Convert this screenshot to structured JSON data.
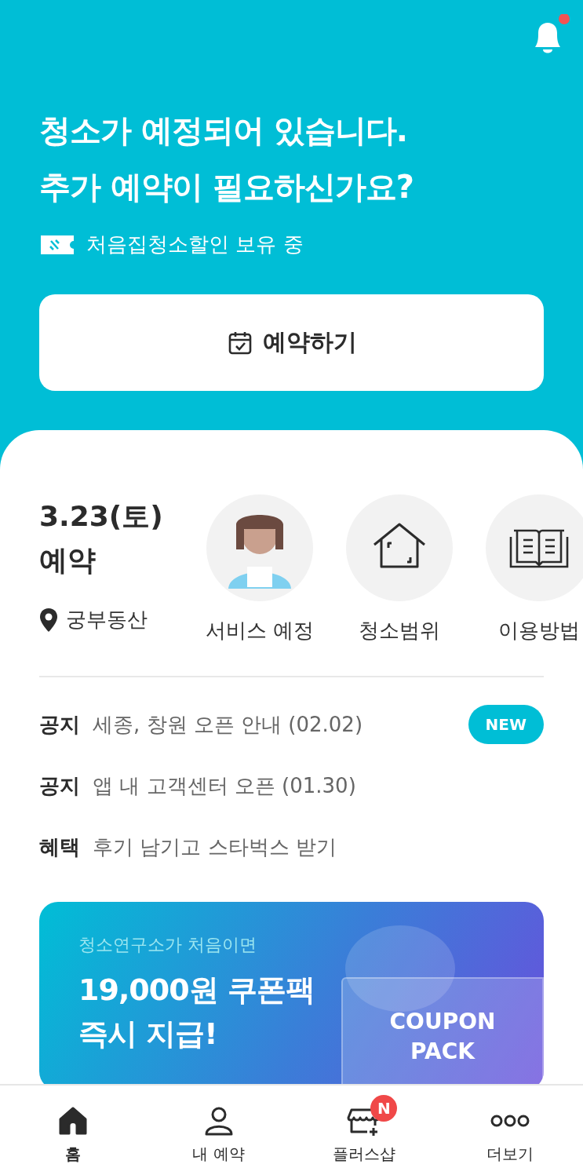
{
  "header": {
    "notification_unread": true,
    "headline": [
      "청소가 예정되어 있습니다.",
      "추가 예약이 필요하신가요?"
    ],
    "coupon_note": "처음집청소할인 보유 중",
    "book_button": "예약하기"
  },
  "booking": {
    "date": "3.23(토)",
    "label": "예약",
    "location": "궁부동산"
  },
  "shortcuts": [
    {
      "kind": "avatar",
      "label": "서비스 예정"
    },
    {
      "kind": "house",
      "label": "청소범위"
    },
    {
      "kind": "book",
      "label": "이용방법"
    }
  ],
  "notices": [
    {
      "tag": "공지",
      "text": "세종, 창원 오픈 안내 (02.02)",
      "is_new": true,
      "badge": "NEW"
    },
    {
      "tag": "공지",
      "text": "앱 내 고객센터 오픈 (01.30)",
      "is_new": false
    },
    {
      "tag": "혜택",
      "text": "후기 남기고 스타벅스 받기",
      "is_new": false
    }
  ],
  "banner": {
    "subtitle": "청소연구소가 처음이면",
    "title": [
      "19,000원 쿠폰팩",
      "즉시 지급!"
    ],
    "card": [
      "COUPON",
      "PACK"
    ]
  },
  "tab_bar": [
    {
      "kind": "home",
      "label": "홈",
      "selected": true
    },
    {
      "kind": "person",
      "label": "내 예약",
      "selected": false
    },
    {
      "kind": "shop",
      "label": "플러스샵",
      "selected": false,
      "badge": "N"
    },
    {
      "kind": "more",
      "label": "더보기",
      "selected": false
    }
  ]
}
